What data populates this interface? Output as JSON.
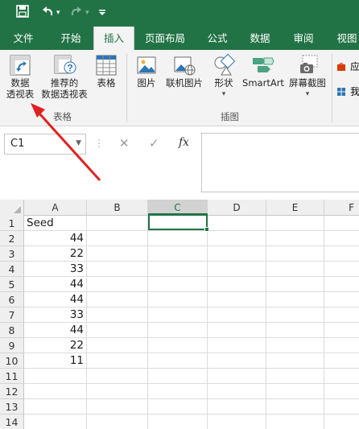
{
  "quick_access": {
    "save_icon": "save-icon",
    "undo_icon": "undo-icon",
    "redo_icon": "redo-icon",
    "customize_icon": "customize-icon"
  },
  "tabs": [
    "文件",
    "开始",
    "插入",
    "页面布局",
    "公式",
    "数据",
    "审阅",
    "视图"
  ],
  "active_tab": "插入",
  "ribbon": {
    "pivot_line1": "数据",
    "pivot_line2": "透视表",
    "rec_pivot_line1": "推荐的",
    "rec_pivot_line2": "数据透视表",
    "table": "表格",
    "group_tables": "表格",
    "picture": "图片",
    "online_picture": "联机图片",
    "shapes": "形状",
    "smartart": "SmartArt",
    "screenshot": "屏幕截图",
    "group_illustrations": "插图",
    "partial_1": "应",
    "partial_2": "我"
  },
  "formula_bar": {
    "name_box": "C1",
    "cancel_icon": "✕",
    "enter_icon": "✓",
    "fx_icon": "fx",
    "formula": ""
  },
  "grid": {
    "columns": [
      "A",
      "B",
      "C",
      "D",
      "E",
      "F"
    ],
    "selected_column": "C",
    "rows": [
      {
        "num": "1",
        "a": "Seed"
      },
      {
        "num": "2",
        "a": "44"
      },
      {
        "num": "3",
        "a": "22"
      },
      {
        "num": "4",
        "a": "33"
      },
      {
        "num": "5",
        "a": "44"
      },
      {
        "num": "6",
        "a": "44"
      },
      {
        "num": "7",
        "a": "33"
      },
      {
        "num": "8",
        "a": "44"
      },
      {
        "num": "9",
        "a": "22"
      },
      {
        "num": "10",
        "a": "11"
      },
      {
        "num": "11",
        "a": ""
      },
      {
        "num": "12",
        "a": ""
      },
      {
        "num": "13",
        "a": ""
      },
      {
        "num": "14",
        "a": ""
      }
    ]
  },
  "colors": {
    "brand": "#217346",
    "annotation_arrow": "#e02020"
  }
}
